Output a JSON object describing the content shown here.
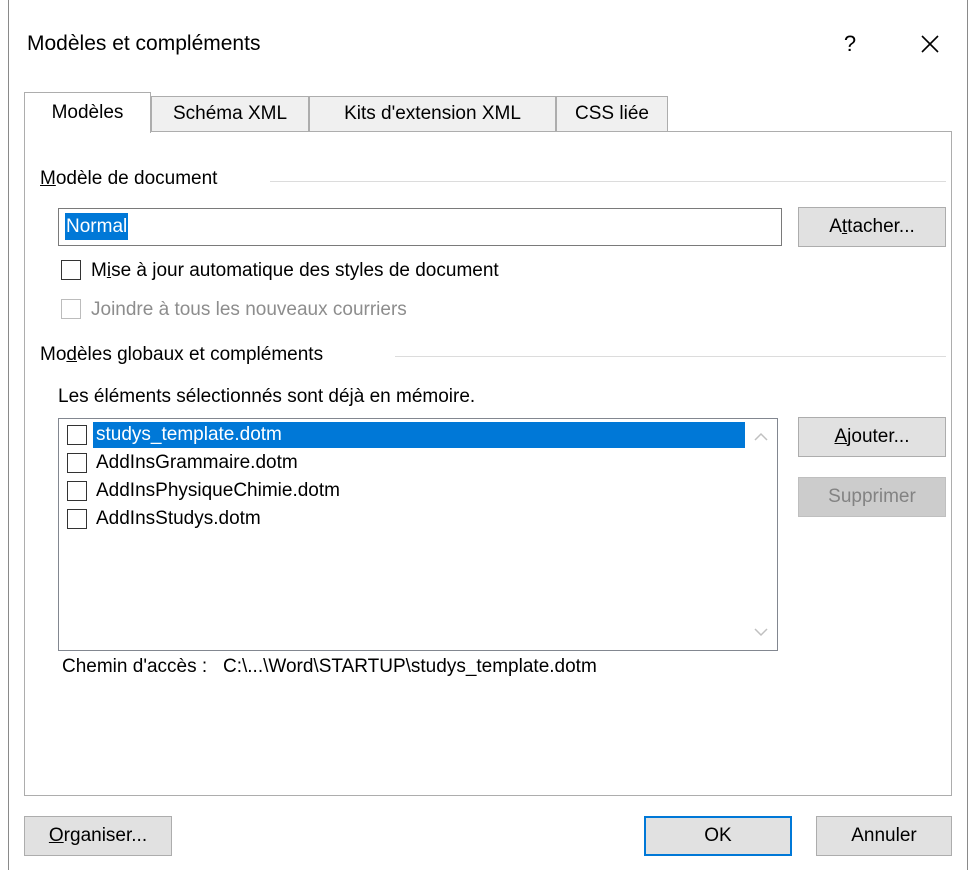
{
  "dialog": {
    "title": "Modèles et compléments",
    "help_label": "?"
  },
  "tabs": [
    {
      "label": "Modèles",
      "active": true
    },
    {
      "label": "Schéma XML",
      "active": false
    },
    {
      "label": "Kits d'extension XML",
      "active": false
    },
    {
      "label": "CSS liée",
      "active": false
    }
  ],
  "document_template": {
    "group_label_pre": "",
    "group_label_u": "M",
    "group_label_post": "odèle de document",
    "value": "Normal",
    "attach_pre": "A",
    "attach_u": "t",
    "attach_post": "tacher...",
    "auto_update_pre": "M",
    "auto_update_u": "i",
    "auto_update_post": "se à jour automatique des styles de document",
    "auto_update_checked": false,
    "attach_mail_label": "Joindre à tous les nouveaux courriers",
    "attach_mail_checked": false
  },
  "global_templates": {
    "group_label_pre": "Mo",
    "group_label_u": "d",
    "group_label_post": "èles globaux et compléments",
    "note": "Les éléments sélectionnés sont déjà en mémoire.",
    "items": [
      {
        "name": "studys_template.dotm",
        "checked": false,
        "selected": true
      },
      {
        "name": "AddInsGrammaire.dotm",
        "checked": false,
        "selected": false
      },
      {
        "name": "AddInsPhysiqueChimie.dotm",
        "checked": false,
        "selected": false
      },
      {
        "name": "AddInsStudys.dotm",
        "checked": false,
        "selected": false
      }
    ],
    "add_pre": "",
    "add_u": "A",
    "add_post": "jouter...",
    "remove_label": "Supprimer",
    "path_label": "Chemin d'accès :",
    "path_value": "C:\\...\\Word\\STARTUP\\studys_template.dotm"
  },
  "footer": {
    "organize_u": "O",
    "organize_post": "rganiser...",
    "ok_label": "OK",
    "cancel_label": "Annuler"
  },
  "colors": {
    "accent": "#0078d7",
    "button_bg": "#e1e1e1",
    "disabled_text": "#838383"
  }
}
